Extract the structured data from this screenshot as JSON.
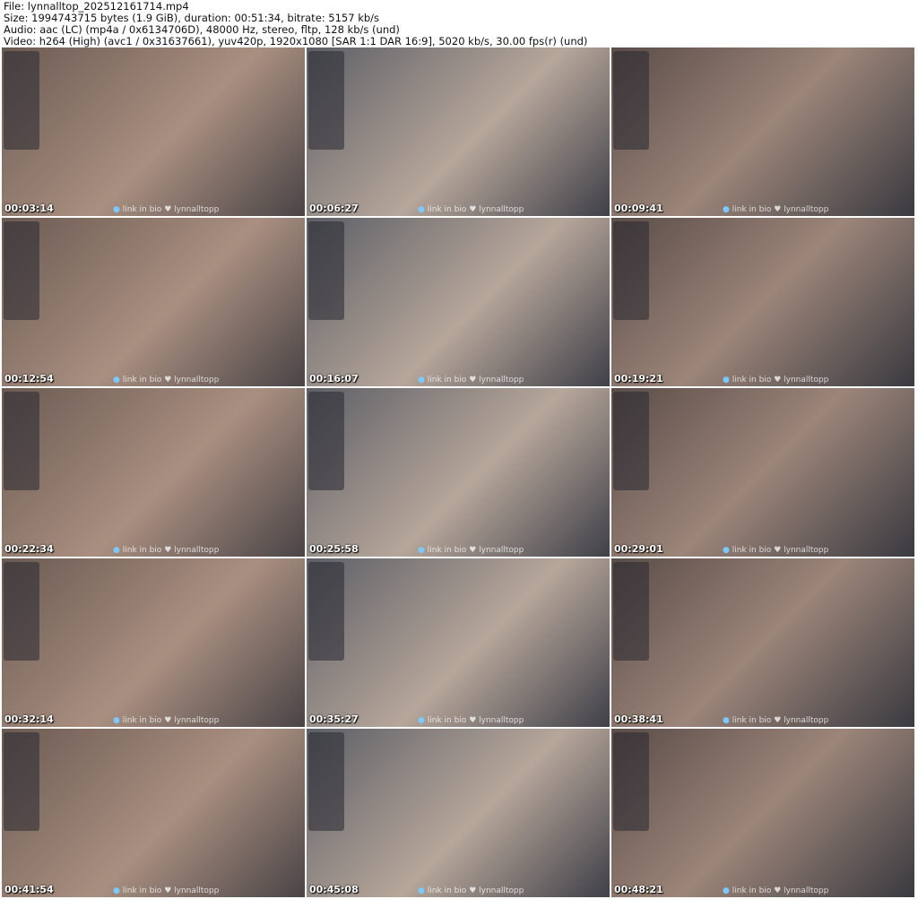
{
  "header": {
    "file": "File: lynnalltop_202512161714.mp4",
    "size": "Size: 1994743715 bytes (1.9 GiB), duration: 00:51:34, bitrate: 5157 kb/s",
    "audio": "Audio: aac (LC) (mp4a / 0x6134706D), 48000 Hz, stereo, fltp, 128 kb/s (und)",
    "video": "Video: h264 (High) (avc1 / 0x31637661), yuv420p, 1920x1080 [SAR 1:1 DAR 16:9], 5020 kb/s, 30.00 fps(r) (und)"
  },
  "watermark": {
    "link": "link in bio",
    "handle": "lynnalltopp"
  },
  "thumbnails": [
    {
      "timestamp": "00:03:14"
    },
    {
      "timestamp": "00:06:27"
    },
    {
      "timestamp": "00:09:41"
    },
    {
      "timestamp": "00:12:54"
    },
    {
      "timestamp": "00:16:07"
    },
    {
      "timestamp": "00:19:21"
    },
    {
      "timestamp": "00:22:34"
    },
    {
      "timestamp": "00:25:58"
    },
    {
      "timestamp": "00:29:01"
    },
    {
      "timestamp": "00:32:14"
    },
    {
      "timestamp": "00:35:27"
    },
    {
      "timestamp": "00:38:41"
    },
    {
      "timestamp": "00:41:54"
    },
    {
      "timestamp": "00:45:08"
    },
    {
      "timestamp": "00:48:21"
    }
  ]
}
